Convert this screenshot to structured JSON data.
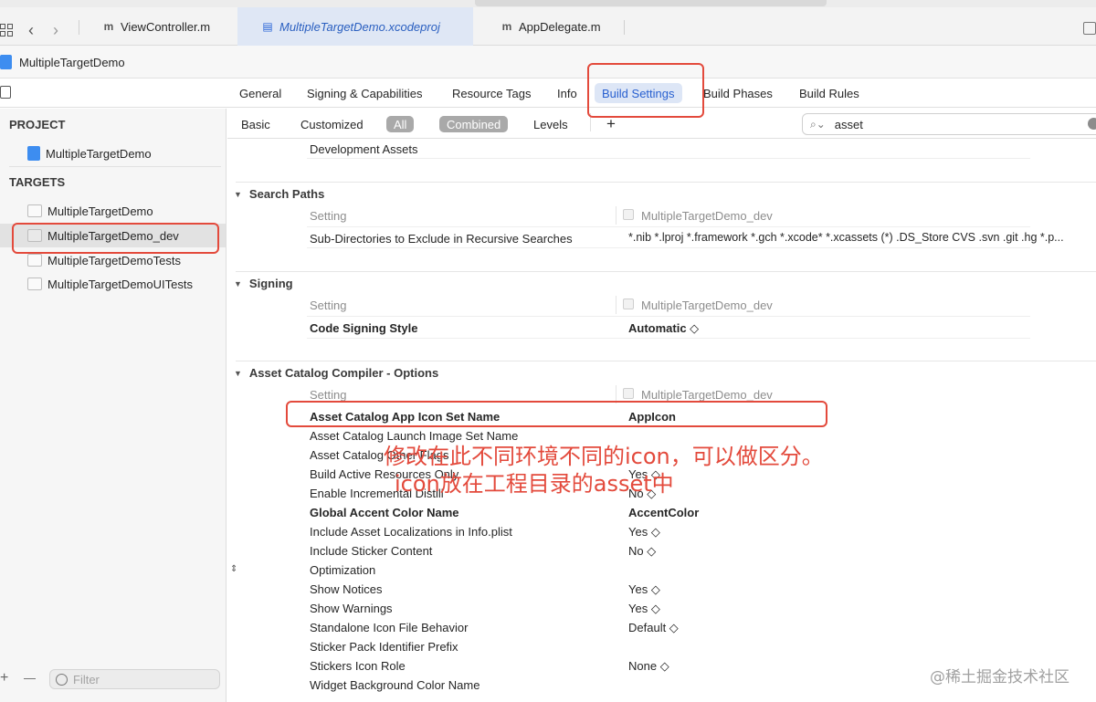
{
  "tabs": [
    {
      "label": "ViewController.m",
      "icon": "m"
    },
    {
      "label": "MultipleTargetDemo.xcodeproj",
      "icon": "proj"
    },
    {
      "label": "AppDelegate.m",
      "icon": "m"
    }
  ],
  "project_header": {
    "title": "MultipleTargetDemo"
  },
  "editor_tabs": [
    "General",
    "Signing & Capabilities",
    "Resource Tags",
    "Info",
    "Build Settings",
    "Build Phases",
    "Build Rules"
  ],
  "sidebar": {
    "project_section": "PROJECT",
    "project_item": "MultipleTargetDemo",
    "targets_section": "TARGETS",
    "targets": [
      "MultipleTargetDemo",
      "MultipleTargetDemo_dev",
      "MultipleTargetDemoTests",
      "MultipleTargetDemoUITests"
    ],
    "filter_placeholder": "Filter",
    "add_label": "+",
    "remove_label": "—"
  },
  "filters": {
    "basic": "Basic",
    "customized": "Customized",
    "all": "All",
    "combined": "Combined",
    "levels": "Levels",
    "add": "+",
    "search_value": "asset"
  },
  "content": {
    "dev_assets": "Development Assets",
    "search_paths": {
      "title": "Search Paths",
      "setting_header": "Setting",
      "target_header": "MultipleTargetDemo_dev",
      "row_name": "Sub-Directories to Exclude in Recursive Searches",
      "row_value": "*.nib *.lproj *.framework *.gch *.xcode* *.xcassets (*) .DS_Store CVS .svn .git .hg *.p..."
    },
    "signing": {
      "title": "Signing",
      "setting_header": "Setting",
      "target_header": "MultipleTargetDemo_dev",
      "row_name": "Code Signing Style",
      "row_value": "Automatic ◇"
    },
    "asset_catalog": {
      "title": "Asset Catalog Compiler - Options",
      "setting_header": "Setting",
      "target_header": "MultipleTargetDemo_dev",
      "rows": [
        {
          "name": "Asset Catalog App Icon Set Name",
          "value": "AppIcon",
          "bold": true
        },
        {
          "name": "Asset Catalog Launch Image Set Name",
          "value": "",
          "bold": false
        },
        {
          "name": "Asset Catalog Other Flags",
          "value": "",
          "bold": false
        },
        {
          "name": "Build Active Resources Only",
          "value": "Yes ◇",
          "bold": false
        },
        {
          "name": "Enable Incremental Distill",
          "value": "No ◇",
          "bold": false
        },
        {
          "name": "Global Accent Color Name",
          "value": "AccentColor",
          "bold": true
        },
        {
          "name": "Include Asset Localizations in Info.plist",
          "value": "Yes ◇",
          "bold": false
        },
        {
          "name": "Include Sticker Content",
          "value": "No ◇",
          "bold": false
        },
        {
          "name": "Optimization",
          "value": "",
          "bold": false
        },
        {
          "name": "Show Notices",
          "value": "Yes ◇",
          "bold": false
        },
        {
          "name": "Show Warnings",
          "value": "Yes ◇",
          "bold": false
        },
        {
          "name": "Standalone Icon File Behavior",
          "value": "Default ◇",
          "bold": false
        },
        {
          "name": "Sticker Pack Identifier Prefix",
          "value": "",
          "bold": false
        },
        {
          "name": "Stickers Icon Role",
          "value": "None ◇",
          "bold": false
        },
        {
          "name": "Widget Background Color Name",
          "value": "",
          "bold": false
        }
      ]
    }
  },
  "annotation": {
    "line1": "修改在此不同环境不同的icon，可以做区分。",
    "line2": "icon放在工程目录的asset中"
  },
  "watermark": "@稀土掘金技术社区",
  "colors": {
    "annotation_red": "#e34a3c",
    "accent_blue": "#2860d0"
  }
}
